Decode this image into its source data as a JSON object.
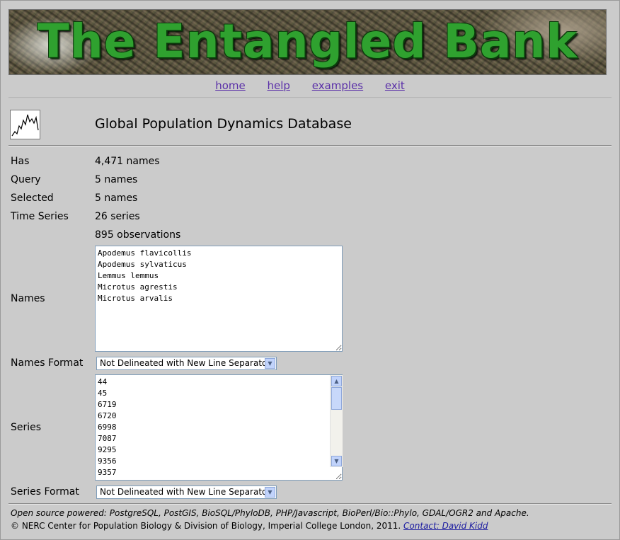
{
  "banner": {
    "title": "The Entangled Bank"
  },
  "nav": [
    {
      "label": "home"
    },
    {
      "label": "help"
    },
    {
      "label": "examples"
    },
    {
      "label": "exit"
    }
  ],
  "database": {
    "title": "Global Population Dynamics Database",
    "icon": "population-chart-icon"
  },
  "stats": {
    "has_label": "Has",
    "has_value": "4,471 names",
    "query_label": "Query",
    "query_value": "5 names",
    "selected_label": "Selected",
    "selected_value": "5 names",
    "timeseries_label": "Time Series",
    "timeseries_value": "26 series",
    "observations_value": "895 observations"
  },
  "names": {
    "label": "Names",
    "value": "Apodemus flavicollis\nApodemus sylvaticus\nLemmus lemmus\nMicrotus agrestis\nMicrotus arvalis"
  },
  "names_format": {
    "label": "Names Format",
    "selected": "Not Delineated with New Line Separator"
  },
  "series": {
    "label": "Series",
    "value": "44\n45\n6719\n6720\n6998\n7087\n9295\n9356\n9357"
  },
  "series_format": {
    "label": "Series Format",
    "selected": "Not Delineated with New Line Separator"
  },
  "footer": {
    "powered": "Open source powered: PostgreSQL, PostGIS, BioSQL/PhyloDB, PHP/Javascript, BioPerl/Bio::Phylo, GDAL/OGR2 and Apache.",
    "copyright": "© NERC Center for Population Biology & Division of Biology, Imperial College London, 2011.",
    "contact": "Contact: David Kidd"
  }
}
